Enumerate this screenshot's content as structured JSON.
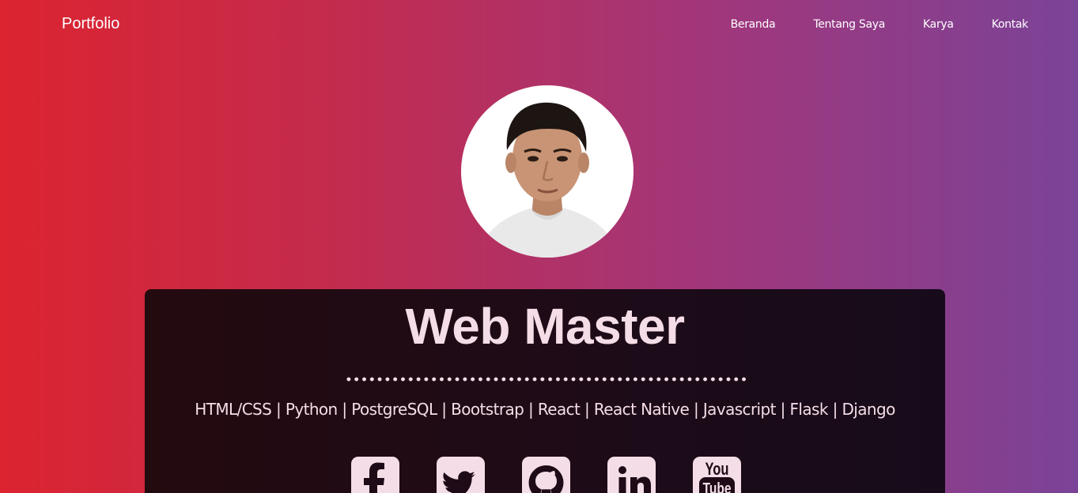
{
  "navbar": {
    "brand": "Portfolio",
    "links": [
      "Beranda",
      "Tentang Saya",
      "Karya",
      "Kontak"
    ]
  },
  "hero": {
    "avatar_icon": "profile-photo",
    "title": "Web Master",
    "skills": "HTML/CSS | Python | PostgreSQL | Bootstrap | React | React Native | Javascript | Flask | Django"
  },
  "socials": [
    {
      "icon": "facebook-icon"
    },
    {
      "icon": "twitter-icon"
    },
    {
      "icon": "github-icon"
    },
    {
      "icon": "linkedin-icon"
    },
    {
      "icon": "youtube-icon",
      "text": "You Tube"
    }
  ],
  "colors": {
    "gradient_start": "#dc2430",
    "gradient_end": "#7b4397",
    "card_bg": "#1e0b17",
    "text_light": "#f4dde6"
  }
}
